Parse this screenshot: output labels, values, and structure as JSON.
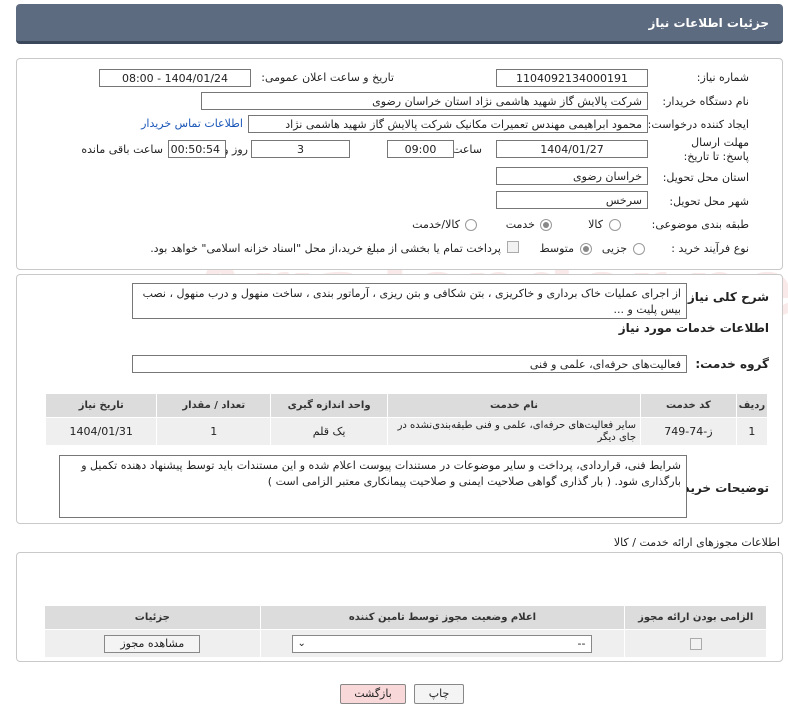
{
  "header": {
    "title": "جزئیات اطلاعات نیاز"
  },
  "need": {
    "need_number_label": "شماره نیاز:",
    "need_number": "1104092134000191",
    "announce_label": "تاریخ و ساعت اعلان عمومی:",
    "announce_value": "1404/01/24 - 08:00",
    "buyer_label": "نام دستگاه خریدار:",
    "buyer_value": "شرکت پالایش گاز شهید هاشمی نژاد   استان خراسان رضوی",
    "requester_label": "ایجاد کننده درخواست:",
    "requester_value": "محمود ابراهیمی مهندس تعمیرات مکانیک شرکت پالایش گاز شهید هاشمی نژاد",
    "contact_link": "اطلاعات تماس خریدار",
    "deadline_label": "مهلت ارسال پاسخ: تا تاریخ:",
    "deadline_date": "1404/01/27",
    "time_label": "ساعت",
    "deadline_time": "09:00",
    "days_value": "3",
    "days_label": "روز و",
    "remaining_value": "00:50:54",
    "remaining_label": "ساعت باقی مانده",
    "province_label": "استان محل تحویل:",
    "province_value": "خراسان رضوی",
    "city_label": "شهر محل تحویل:",
    "city_value": "سرخس",
    "category_label": "طبقه بندی موضوعی:",
    "category_options": [
      "کالا",
      "خدمت",
      "کالا/خدمت"
    ],
    "process_label": "نوع فرآیند خرید :",
    "process_options": [
      "جزیی",
      "متوسط"
    ],
    "payment_text": "پرداخت تمام یا بخشی از مبلغ خرید،از محل \"اسناد خزانه اسلامی\" خواهد بود."
  },
  "description": {
    "label": "شرح کلی نیاز:",
    "text": "از اجرای عملیات خاک برداری و خاکریزی ، بتن شکافی و بتن ریزی ، آرماتور بندی ، ساخت منهول و درب منهول ، نصب بیس پلیت و ..."
  },
  "services": {
    "section_title": "اطلاعات خدمات مورد نیاز",
    "group_label": "گروه خدمت:",
    "group_value": "فعالیت‌های حرفه‌ای، علمی و فنی",
    "columns": [
      "ردیف",
      "کد خدمت",
      "نام خدمت",
      "واحد اندازه گیری",
      "تعداد / مقدار",
      "تاریخ نیاز"
    ],
    "rows": [
      [
        "1",
        "ز-74-749",
        "سایر فعالیت‌های حرفه‌ای، علمی و فنی طبقه‌بندی‌نشده در جای دیگر",
        "یک قلم",
        "1",
        "1404/01/31"
      ]
    ]
  },
  "buyer_notes": {
    "label": "توضیحات خریدار:",
    "text": "شرایط فنی، قراردادی، پرداخت و سایر موضوعات در مستندات پیوست اعلام شده و این مستندات باید توسط پیشنهاد دهنده تکمیل و  بارگذاری شود. ( بار گذاری گواهی صلاحیت ایمنی و صلاحیت پیمانکاری معتبر الزامی است )"
  },
  "permits": {
    "section_title": "اطلاعات مجوزهای ارائه خدمت / کالا",
    "columns": [
      "الزامی بودن ارائه مجوز",
      "اعلام وضعیت مجوز توسط تامین کننده",
      "جزئیات"
    ],
    "select_value": "--",
    "view_button": "مشاهده مجوز"
  },
  "footer": {
    "print_button": "چاپ",
    "back_button": "بازگشت"
  },
  "watermark": "AriaTender.neT",
  "colors": {
    "header_bg": "#5d6b80",
    "link": "#1a56b8"
  }
}
